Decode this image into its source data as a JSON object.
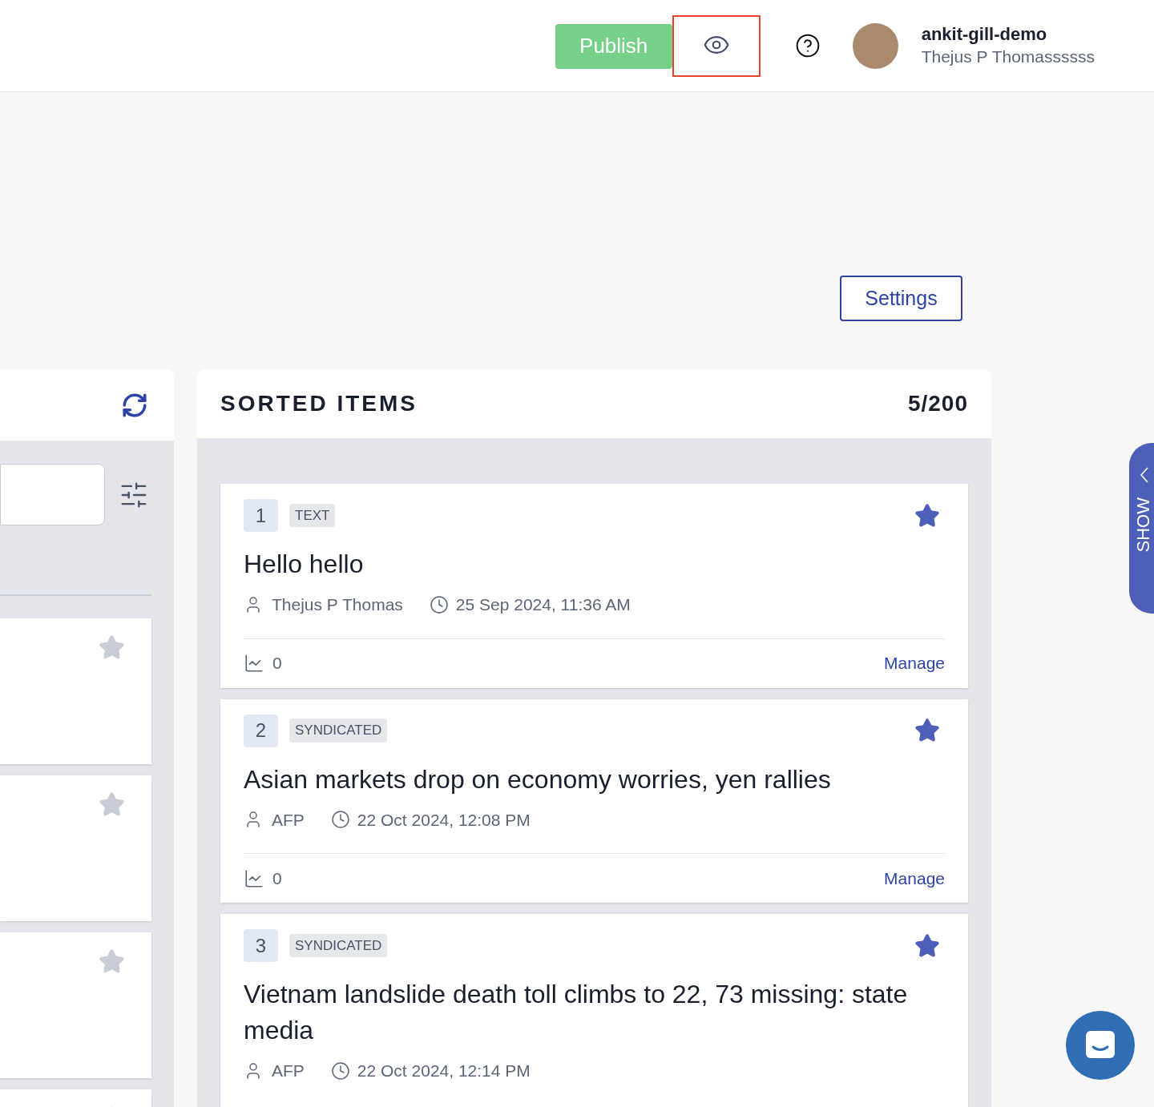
{
  "header": {
    "publish_button": "Publish",
    "preview_highlighted": true,
    "account": {
      "workspace": "ankit-gill-demo",
      "user": "Thejus P Thomassssss"
    }
  },
  "settings_button": "Settings",
  "left_panel": {
    "cards": [
      {
        "starred": false
      },
      {
        "starred": false
      },
      {
        "starred": false
      },
      {
        "starred": false
      }
    ]
  },
  "sorted_items": {
    "title": "SORTED ITEMS",
    "count": "5/200",
    "items": [
      {
        "number": "1",
        "type": "TEXT",
        "title": "Hello hello",
        "author": "Thejus P Thomas",
        "date": "25 Sep 2024, 11:36 AM",
        "views": "0",
        "action": "Manage",
        "starred": true
      },
      {
        "number": "2",
        "type": "SYNDICATED",
        "title": "Asian markets drop on economy worries, yen rallies",
        "author": "AFP",
        "date": "22 Oct 2024, 12:08 PM",
        "views": "0",
        "action": "Manage",
        "starred": true
      },
      {
        "number": "3",
        "type": "SYNDICATED",
        "title": "Vietnam landslide death toll climbs to 22, 73 missing: state media",
        "author": "AFP",
        "date": "22 Oct 2024, 12:14 PM",
        "starred": true
      }
    ]
  },
  "side_tab": {
    "label": "SHOW"
  }
}
